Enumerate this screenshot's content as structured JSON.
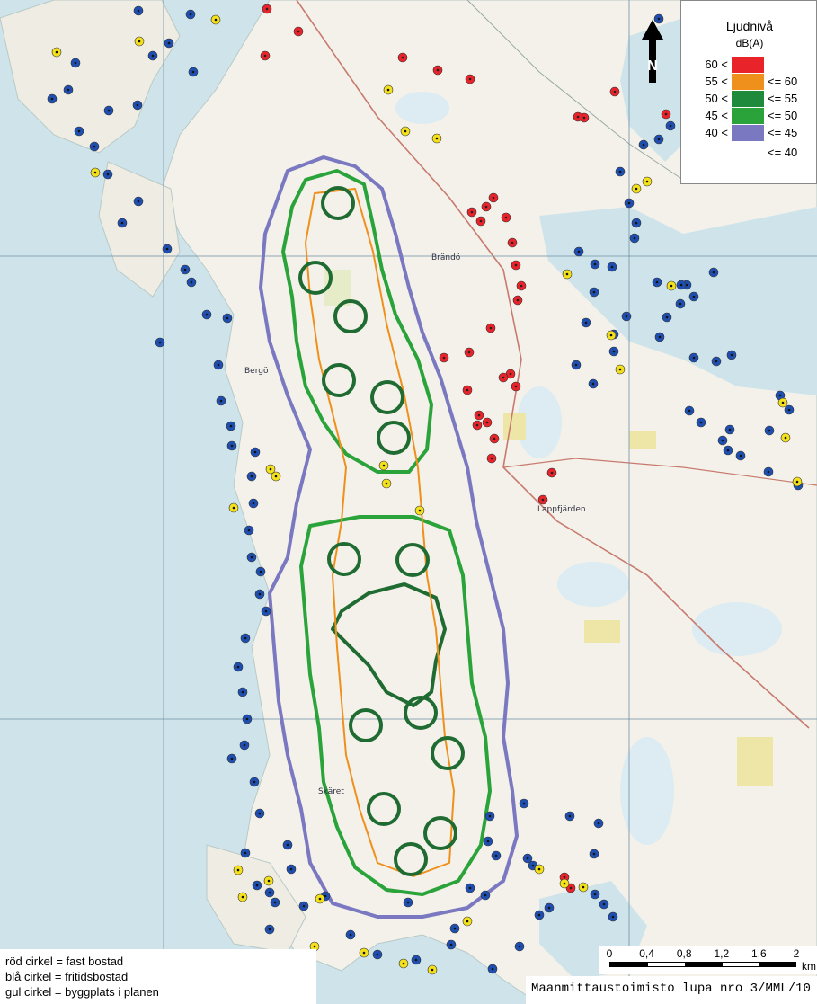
{
  "legend": {
    "title": "Ljudnivå",
    "unit": "dB(A)",
    "rows": [
      {
        "lower": "60 <",
        "upper": "",
        "color": "#e8232a"
      },
      {
        "lower": "55 <",
        "upper": "<= 60",
        "color": "#f0901c"
      },
      {
        "lower": "50 <",
        "upper": "<= 55",
        "color": "#1f8a3c"
      },
      {
        "lower": "45 <",
        "upper": "<= 50",
        "color": "#2aa33a"
      },
      {
        "lower": "40 <",
        "upper": "<= 45",
        "color": "#7a78c0"
      },
      {
        "lower": "",
        "upper": "<= 40",
        "color": "#ffffff"
      }
    ]
  },
  "north_arrow": {
    "label": "N",
    "icon": "north-arrow-icon"
  },
  "caption": {
    "lines": [
      "röd cirkel = fast bostad",
      "blå cirkel = fritidsbostad",
      "gul cirkel = byggplats i planen"
    ]
  },
  "scale_bar": {
    "ticks": [
      "0",
      "0,4",
      "0,8",
      "1,2",
      "1,6",
      "2"
    ],
    "unit": "km"
  },
  "license": {
    "text": "Maanmittaustoimisto lupa nro 3/MML/10"
  },
  "place_names": [
    "Brändö",
    "Bergö",
    "Lappfjärden",
    "Skäret"
  ],
  "colors": {
    "sea": "#cfe4ea",
    "land": "#f3f1ea",
    "lake": "#dcecf2",
    "fast_bostad": "#e8232a",
    "fritidsbostad": "#1e4fb0",
    "byggplats": "#f4e11c",
    "contour_40": "#7a78c0",
    "contour_45": "#2aa33a",
    "contour_50": "#1f8a3c",
    "contour_55": "#f0901c"
  }
}
